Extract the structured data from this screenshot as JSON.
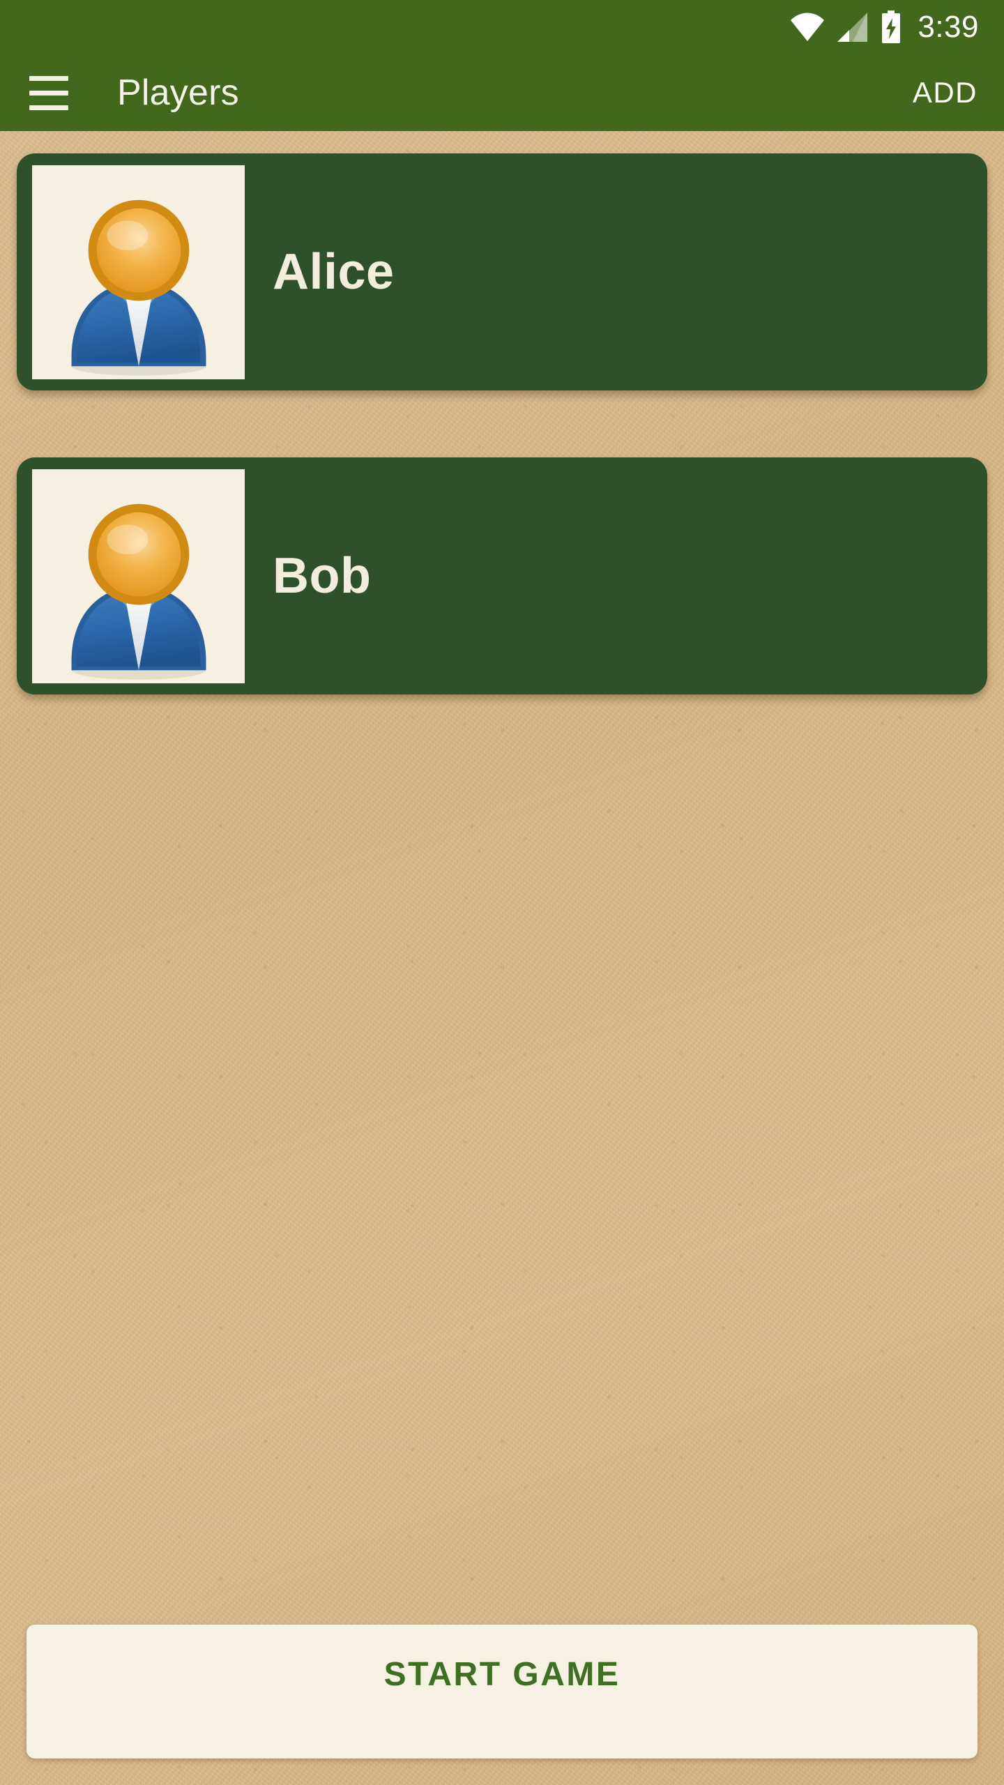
{
  "status_bar": {
    "time": "3:39",
    "icons": [
      "wifi-icon",
      "cellular-signal-icon",
      "battery-charging-icon"
    ],
    "background_color": "#41681d"
  },
  "app_bar": {
    "menu_icon": "hamburger-menu-icon",
    "title": "Players",
    "action_label": "ADD",
    "background_color": "#41681d",
    "text_color": "#f3f2e6"
  },
  "theme": {
    "background_color": "#d9ba8e",
    "card_color": "#2e5129",
    "card_text_color": "#f2eddc",
    "avatar_panel_color": "#f5f0e2",
    "accent_green": "#3d7023"
  },
  "player_list": {
    "players": [
      {
        "name": "Alice",
        "avatar": "person-avatar-icon"
      },
      {
        "name": "Bob",
        "avatar": "person-avatar-icon"
      }
    ]
  },
  "start_game": {
    "label": "START GAME",
    "background_color": "#f6f1e3",
    "text_color": "#3d7023"
  }
}
